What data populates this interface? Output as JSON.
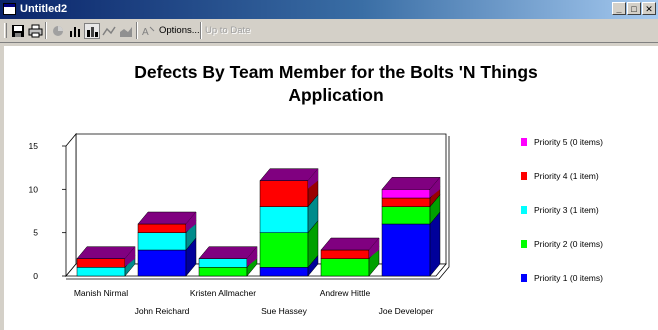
{
  "window": {
    "title": "Untitled2",
    "buttons": {
      "minimize": "_",
      "maximize": "□",
      "close": "✕"
    }
  },
  "toolbar": {
    "options_label": "Options...",
    "up_to_date_label": "Up to Date",
    "icons": [
      "save-icon",
      "print-icon",
      "pie-chart-icon",
      "bar-chart-icon",
      "stacked-bar-chart-icon",
      "line-chart-icon",
      "area-chart-icon",
      "text-format-icon"
    ]
  },
  "chart_data": {
    "type": "bar",
    "stacked": true,
    "three_d": true,
    "title": "Defects By Team Member for the Bolts 'N Things Application",
    "title_lines": [
      "Defects By Team Member for the Bolts 'N Things",
      "Application"
    ],
    "categories": [
      "Manish Nirmal",
      "John Reichard",
      "Kristen Allmacher",
      "Sue Hassey",
      "Andrew Hittle",
      "Joe Developer"
    ],
    "yticks": [
      0,
      5,
      10,
      15
    ],
    "ylim": [
      0,
      15
    ],
    "grid": false,
    "legend_position": "right",
    "series": [
      {
        "name": "Priority 1 (0 items)",
        "color": "#0000ff",
        "side_color": "#00009a",
        "values": [
          0,
          3,
          0,
          1,
          0,
          6
        ]
      },
      {
        "name": "Priority 2 (0 items)",
        "color": "#00ff00",
        "side_color": "#00a000",
        "values": [
          0,
          0,
          1,
          4,
          2,
          2
        ]
      },
      {
        "name": "Priority 3 (1 item)",
        "color": "#00ffff",
        "side_color": "#008b8b",
        "values": [
          1,
          2,
          1,
          3,
          0,
          0
        ]
      },
      {
        "name": "Priority 4 (1 item)",
        "color": "#ff0000",
        "side_color": "#9a0000",
        "values": [
          1,
          1,
          0,
          3,
          1,
          1
        ]
      },
      {
        "name": "Priority 5 (0 items)",
        "color": "#ff00ff",
        "side_color": "#9a009a",
        "values": [
          0,
          0,
          0,
          0,
          0,
          1
        ]
      }
    ],
    "top_color": "#800080"
  }
}
